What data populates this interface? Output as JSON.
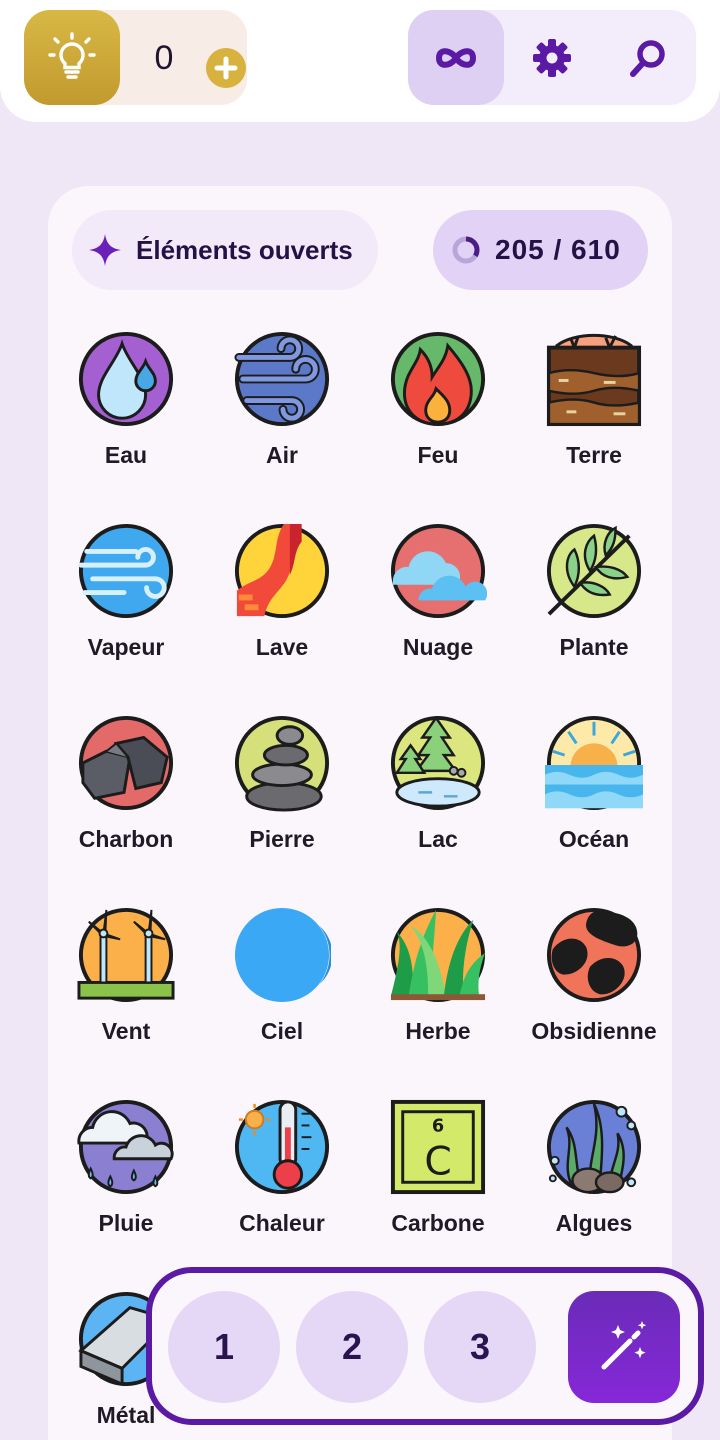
{
  "topbar": {
    "hint_count": "0",
    "hint_icon": "lightbulb-icon",
    "add_icon": "plus-icon",
    "tools": [
      {
        "icon": "infinity-icon",
        "active": true
      },
      {
        "icon": "gear-icon",
        "active": false
      },
      {
        "icon": "search-icon",
        "active": false
      }
    ]
  },
  "panel": {
    "opened_label": "Éléments ouverts",
    "progress_text": "205 / 610",
    "progress": {
      "opened": 205,
      "total": 610
    }
  },
  "elements": [
    {
      "name": "Eau",
      "icon": "water-drop-icon"
    },
    {
      "name": "Air",
      "icon": "wind-swirl-icon"
    },
    {
      "name": "Feu",
      "icon": "fire-icon"
    },
    {
      "name": "Terre",
      "icon": "soil-layers-icon"
    },
    {
      "name": "Vapeur",
      "icon": "steam-icon"
    },
    {
      "name": "Lave",
      "icon": "lava-icon"
    },
    {
      "name": "Nuage",
      "icon": "cloud-icon"
    },
    {
      "name": "Plante",
      "icon": "leaf-branch-icon"
    },
    {
      "name": "Charbon",
      "icon": "coal-icon"
    },
    {
      "name": "Pierre",
      "icon": "stacked-stones-icon"
    },
    {
      "name": "Lac",
      "icon": "lake-trees-icon"
    },
    {
      "name": "Océan",
      "icon": "sunset-ocean-icon"
    },
    {
      "name": "Vent",
      "icon": "wind-turbines-icon"
    },
    {
      "name": "Ciel",
      "icon": "sky-circle-icon"
    },
    {
      "name": "Herbe",
      "icon": "grass-icon"
    },
    {
      "name": "Obsidienne",
      "icon": "obsidian-icon"
    },
    {
      "name": "Pluie",
      "icon": "rain-cloud-icon"
    },
    {
      "name": "Chaleur",
      "icon": "thermometer-sun-icon"
    },
    {
      "name": "Carbone",
      "icon": "carbon-element-icon",
      "element_number": "6",
      "element_symbol": "C"
    },
    {
      "name": "Algues",
      "icon": "seaweed-icon"
    },
    {
      "name": "Métal",
      "icon": "metal-ingot-icon"
    }
  ],
  "combine": {
    "slots": [
      "1",
      "2",
      "3"
    ],
    "action_icon": "magic-wand-icon"
  },
  "colors": {
    "accent": "#5a1aa3",
    "hint_gold": "#c9a133",
    "page_bg": "#efe6f6"
  }
}
